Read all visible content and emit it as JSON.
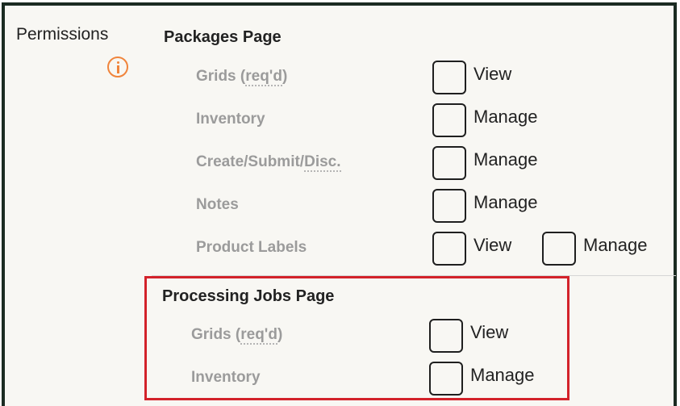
{
  "permissions": {
    "label": "Permissions"
  },
  "packages": {
    "title": "Packages Page",
    "rows": [
      {
        "pre": "Grids (",
        "u": "req'd",
        "post": ")",
        "opts": [
          "View"
        ]
      },
      {
        "pre": "Inventory",
        "u": "",
        "post": "",
        "opts": [
          "Manage"
        ]
      },
      {
        "pre": "Create/Submit/",
        "u": "Disc.",
        "post": "",
        "opts": [
          "Manage"
        ]
      },
      {
        "pre": "Notes",
        "u": "",
        "post": "",
        "opts": [
          "Manage"
        ]
      },
      {
        "pre": "Product Labels",
        "u": "",
        "post": "",
        "opts": [
          "View",
          "Manage"
        ]
      }
    ]
  },
  "processing": {
    "title": "Processing Jobs Page",
    "rows": [
      {
        "pre": "Grids (",
        "u": "req'd",
        "post": ")",
        "opts": [
          "View"
        ]
      },
      {
        "pre": "Inventory",
        "u": "",
        "post": "",
        "opts": [
          "Manage"
        ]
      }
    ]
  },
  "colors": {
    "border": "#1b2b22",
    "accent": "#f0843b",
    "highlight": "#d3222a"
  },
  "icons": {
    "info": "info-circle-icon"
  }
}
